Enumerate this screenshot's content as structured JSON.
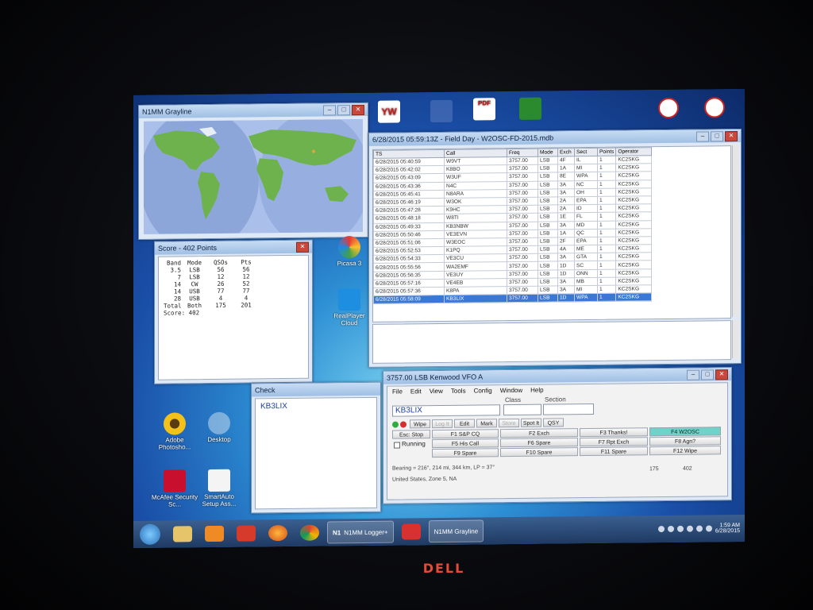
{
  "graylines": {
    "title": "N1MM Grayline"
  },
  "score": {
    "title": "Score - 402 Points",
    "headers": [
      "Band",
      "Mode",
      "QSOs",
      "Pts"
    ],
    "rows": [
      [
        "3.5",
        "LSB",
        "56",
        "56"
      ],
      [
        "7",
        "LSB",
        "12",
        "12"
      ],
      [
        "14",
        "CW",
        "26",
        "52"
      ],
      [
        "14",
        "USB",
        "77",
        "77"
      ],
      [
        "28",
        "USB",
        "4",
        "4"
      ],
      [
        "Total",
        "Both",
        "175",
        "201"
      ]
    ],
    "score_line": "Score: 402"
  },
  "desktop_icons": [
    {
      "label": "Picasa 3"
    },
    {
      "label": "RealPlayer Cloud"
    },
    {
      "label": "Adobe Photosho..."
    },
    {
      "label": "Desktop"
    },
    {
      "label": "McAfee Security Sc..."
    },
    {
      "label": "SmartAuto Setup Ass..."
    }
  ],
  "top_icons": [
    {
      "label": "YW"
    },
    {
      "label": "PDF"
    }
  ],
  "log": {
    "title": "6/28/2015 05:59:13Z - Field Day - W2OSC-FD-2015.mdb",
    "headers": [
      "TS",
      "Call",
      "Freq",
      "Mode",
      "Exch",
      "Sect",
      "Points",
      "Operator"
    ],
    "rows": [
      [
        "6/28/2015 05:40:59",
        "W9VT",
        "3757.00",
        "LSB",
        "4F",
        "IL",
        "1",
        "KC2SKG"
      ],
      [
        "6/28/2015 05:42:02",
        "K8BO",
        "3757.00",
        "LSB",
        "1A",
        "MI",
        "1",
        "KC2SKG"
      ],
      [
        "6/28/2015 05:43:09",
        "W3UF",
        "3757.00",
        "LSB",
        "8E",
        "WPA",
        "1",
        "KC2SKG"
      ],
      [
        "6/28/2015 05:43:36",
        "N4C",
        "3757.00",
        "LSB",
        "3A",
        "NC",
        "1",
        "KC2SKG"
      ],
      [
        "6/28/2015 05:45:41",
        "N8ARA",
        "3757.00",
        "LSB",
        "3A",
        "OH",
        "1",
        "KC2SKG"
      ],
      [
        "6/28/2015 05:46:19",
        "W3OK",
        "3757.00",
        "LSB",
        "2A",
        "EPA",
        "1",
        "KC2SKG"
      ],
      [
        "6/28/2015 05:47:28",
        "K9HC",
        "3757.00",
        "LSB",
        "2A",
        "ID",
        "1",
        "KC2SKG"
      ],
      [
        "6/28/2015 05:48:18",
        "W8TI",
        "3757.00",
        "LSB",
        "1E",
        "FL",
        "1",
        "KC2SKG"
      ],
      [
        "6/28/2015 05:49:33",
        "KB3NBW",
        "3757.00",
        "LSB",
        "3A",
        "MD",
        "1",
        "KC2SKG"
      ],
      [
        "6/28/2015 05:50:46",
        "VE3EVN",
        "3757.00",
        "LSB",
        "1A",
        "QC",
        "1",
        "KC2SKG"
      ],
      [
        "6/28/2015 05:51:06",
        "W3EOC",
        "3757.00",
        "LSB",
        "2F",
        "EPA",
        "1",
        "KC2SKG"
      ],
      [
        "6/28/2015 05:52:53",
        "K1PQ",
        "3757.00",
        "LSB",
        "4A",
        "ME",
        "1",
        "KC2SKG"
      ],
      [
        "6/28/2015 05:54:33",
        "VE3CU",
        "3757.00",
        "LSB",
        "3A",
        "GTA",
        "1",
        "KC2SKG"
      ],
      [
        "6/28/2015 05:55:56",
        "WA2EMF",
        "3757.00",
        "LSB",
        "1D",
        "SC",
        "1",
        "KC2SKG"
      ],
      [
        "6/28/2015 05:56:35",
        "VE3UY",
        "3757.00",
        "LSB",
        "1D",
        "ONN",
        "1",
        "KC2SKG"
      ],
      [
        "6/28/2015 05:57:16",
        "VE4EB",
        "3757.00",
        "LSB",
        "3A",
        "MB",
        "1",
        "KC2SKG"
      ],
      [
        "6/28/2015 05:57:36",
        "K8PA",
        "3757.00",
        "LSB",
        "3A",
        "MI",
        "1",
        "KC2SKG"
      ],
      [
        "6/28/2015 05:58:09",
        "KB3LIX",
        "3757.00",
        "LSB",
        "1D",
        "WPA",
        "1",
        "KC2SKG"
      ]
    ]
  },
  "check": {
    "title": "Check",
    "value": "KB3LIX"
  },
  "entry": {
    "title": "3757.00 LSB Kenwood VFO A",
    "menu": [
      "File",
      "Edit",
      "View",
      "Tools",
      "Config",
      "Window",
      "Help"
    ],
    "labels": {
      "class": "Class",
      "section": "Section"
    },
    "call_value": "KB3LIX",
    "buttons": {
      "wipe": "Wipe",
      "log": "Log It",
      "edit": "Edit",
      "mark": "Mark",
      "store": "Store",
      "spot": "Spot It",
      "qsy": "QSY",
      "esc": "Esc: Stop",
      "running": "Running",
      "f1": "F1 S&P CQ",
      "f2": "F2 Exch",
      "f3": "F3 Thanks!",
      "f4": "F4 W2OSC",
      "f5": "F5 His Call",
      "f6": "F6 Spare",
      "f7": "F7 Rpt Exch",
      "f8": "F8 Agn?",
      "f9": "F9 Spare",
      "f10": "F10 Spare",
      "f11": "F11 Spare",
      "f12": "F12 Wipe"
    },
    "bearing": "Bearing = 216°, 214 mi, 344 km, LP = 37°",
    "status": "United States, Zone 5, NA",
    "count_qsos": "175",
    "count_points": "402"
  },
  "taskbar": {
    "n1mm_label": "N1MM Logger+",
    "grayline_label": "N1MM Grayline",
    "clock_time": "1:59 AM",
    "clock_date": "6/28/2015"
  },
  "brand": "DELL"
}
